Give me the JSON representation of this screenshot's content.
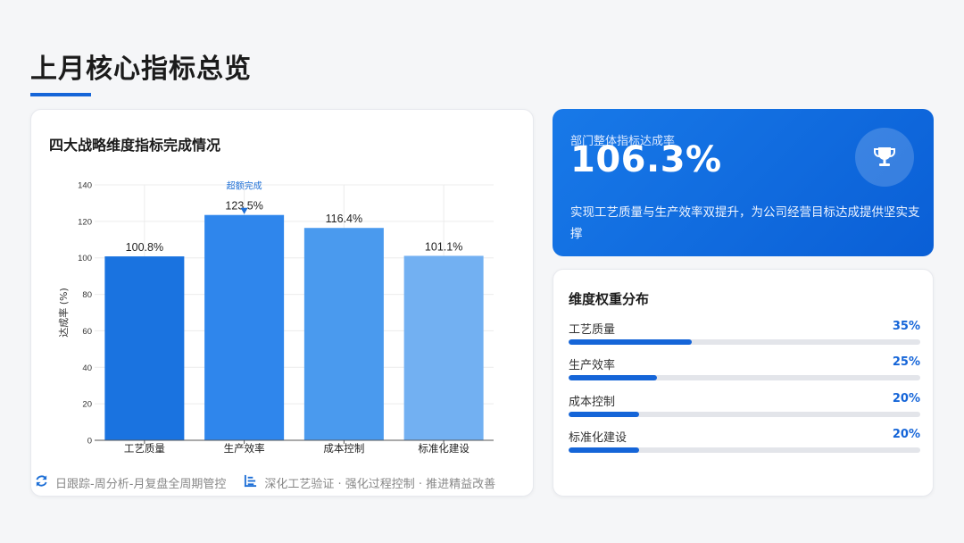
{
  "page": {
    "title": "上月核心指标总览"
  },
  "colors": {
    "accent": "#1565d8",
    "bar_1": "#1a73e0",
    "bar_2": "#2f86ec",
    "bar_3": "#4a9aee",
    "bar_4": "#72b0f2",
    "hero_bg": "#0a66da"
  },
  "chart_data": {
    "type": "bar",
    "title": "四大战略维度指标完成情况",
    "categories": [
      "工艺质量",
      "生产效率",
      "成本控制",
      "标准化建设"
    ],
    "values": [
      100.8,
      123.5,
      116.4,
      101.1
    ],
    "data_labels": [
      "100.8%",
      "123.5%",
      "116.4%",
      "101.1%"
    ],
    "xlabel": "",
    "ylabel": "达成率 (%)",
    "ylim": [
      0,
      140
    ],
    "yticks": [
      0,
      20,
      40,
      60,
      80,
      100,
      120,
      140
    ],
    "grid": true,
    "annotation": {
      "text": "超额完成",
      "category": "生产效率"
    }
  },
  "chart_footer": {
    "item1_icon": "refresh-icon",
    "item1_text": "日跟踪-周分析-月复盘全周期管控",
    "item2_icon": "list-icon",
    "item2_text": "深化工艺验证 · 强化过程控制 · 推进精益改善"
  },
  "hero": {
    "label": "部门整体指标达成率",
    "value": "106.3%",
    "description": "实现工艺质量与生产效率双提升，为公司经营目标达成提供坚实支撑",
    "icon": "trophy-icon"
  },
  "weights": {
    "title": "维度权重分布",
    "items": [
      {
        "name": "工艺质量",
        "percent_label": "35%",
        "value": 0.35
      },
      {
        "name": "生产效率",
        "percent_label": "25%",
        "value": 0.25
      },
      {
        "name": "成本控制",
        "percent_label": "20%",
        "value": 0.2
      },
      {
        "name": "标准化建设",
        "percent_label": "20%",
        "value": 0.2
      }
    ]
  }
}
